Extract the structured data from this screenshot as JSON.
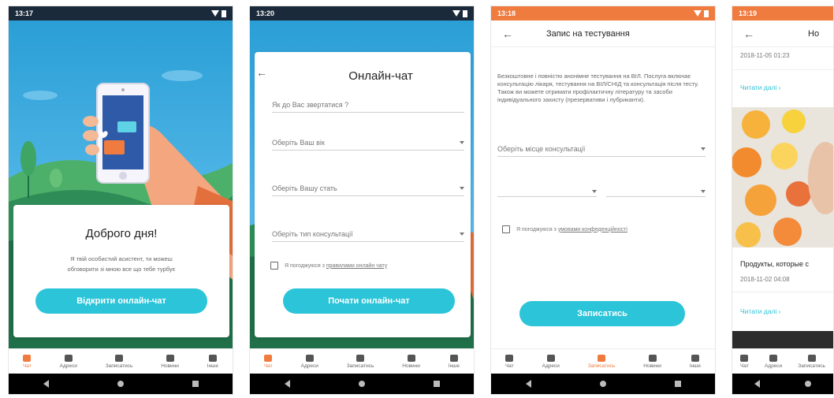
{
  "screens": [
    {
      "status_time": "13:17",
      "greeting_title": "Доброго дня!",
      "greeting_text_1": "Я твій особистий асистент, ти можеш",
      "greeting_text_2": "обговорити зі мною все що тебе турбує",
      "open_chat_button": "Відкрити онлайн-чат"
    },
    {
      "status_time": "13:20",
      "title": "Онлайн-чат",
      "name_placeholder": "Як до Вас звертатися ?",
      "age_select": "Оберіть Ваш вік",
      "gender_select": "Оберіть Вашу стать",
      "consult_select": "Оберіть тип консультації",
      "agree_prefix": "Я погоджуюся з",
      "agree_link": "правилами онлайн чату",
      "start_button": "Почати онлайн-чат"
    },
    {
      "status_time": "13:18",
      "title": "Запис на тестування",
      "description": "Безкоштовне і повністю анонімне тестування на ВІЛ. Послуга включає консультацію лікаря, тестування на ВІЛ/СНІД та консультація після тесту. Також ви можете отримати профілактичну літературу та засоби індивідуального захисту (презервативи і лубриканти).",
      "place_select": "Оберіть місце консультації",
      "agree_prefix": "Я погоджуюся з",
      "agree_link": "умовами конфеденційності",
      "submit_button": "Записатись"
    },
    {
      "status_time": "13:19",
      "title": "Но",
      "date1": "2018-11-05 01:23",
      "read_more": "Читати далі",
      "news_title": "Продукты, которые с",
      "date2": "2018-11-02 04:08",
      "read_more2": "Читати далі"
    }
  ],
  "nav": {
    "items": [
      "Чат",
      "Адреси",
      "Записатись",
      "Новини",
      "Інше"
    ]
  },
  "colors": {
    "accent": "#2bc4d8",
    "orange": "#f07b3f"
  }
}
